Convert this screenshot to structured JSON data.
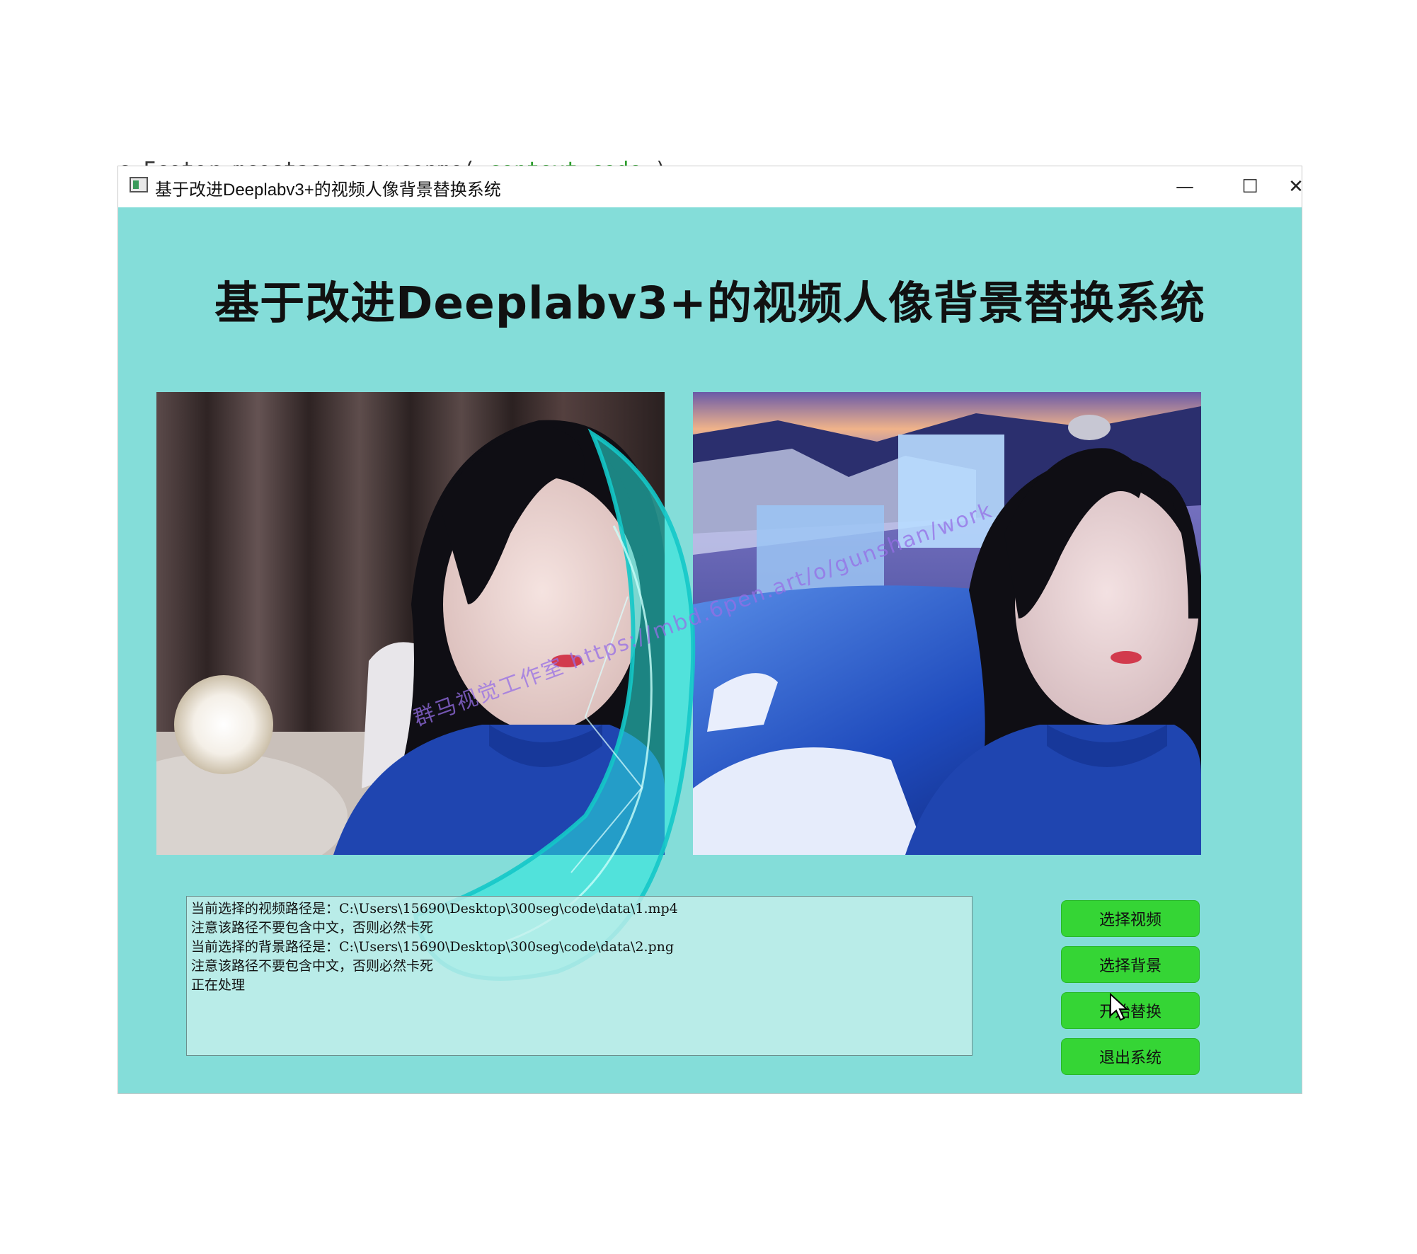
{
  "window": {
    "title": "基于改进Deeplabv3+的视频人像背景替换系统",
    "minimize_glyph": "—",
    "maximize_glyph": "☐",
    "close_glyph": "✕"
  },
  "main": {
    "heading": "基于改进Deeplabv3+的视频人像背景替换系统"
  },
  "log": {
    "lines": [
      "当前选择的视频路径是：C:\\Users\\15690\\Desktop\\300seg\\code\\data\\1.mp4",
      "注意该路径不要包含中文，否则必然卡死",
      "当前选择的背景路径是：C:\\Users\\15690\\Desktop\\300seg\\code\\data\\2.png",
      "注意该路径不要包含中文，否则必然卡死",
      "正在处理"
    ]
  },
  "buttons": {
    "select_video": "选择视频",
    "select_background": "选择背景",
    "start_replace": "开始替换",
    "exit_system": "退出系统"
  },
  "overlay": {
    "watermark": "群马视觉工作室 https://mbd.6pen.art/o/gunshan/work"
  },
  "colors": {
    "content_bg": "#84ddd9",
    "button_green": "#35d535",
    "log_bg": "#c8f0ec"
  },
  "icons": [
    "app-icon",
    "minimize-icon",
    "maximize-icon",
    "close-icon",
    "mouse-cursor-icon"
  ]
}
